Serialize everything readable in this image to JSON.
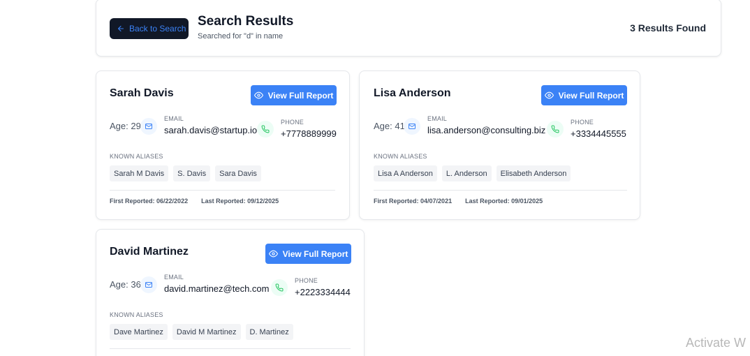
{
  "header": {
    "back_label": "Back to Search",
    "title": "Search Results",
    "subtitle": "Searched for \"d\" in name",
    "result_count": "3 Results Found"
  },
  "labels": {
    "email": "EMAIL",
    "phone": "PHONE",
    "known_aliases": "KNOWN ALIASES",
    "view_report": "View Full Report",
    "first_reported": "First Reported:",
    "last_reported": "Last Reported:"
  },
  "results": [
    {
      "name": "Sarah Davis",
      "age": "Age: 29",
      "email": "sarah.davis@startup.io",
      "phone": "+7778889999",
      "aliases": [
        "Sarah M Davis",
        "S. Davis",
        "Sara Davis"
      ],
      "first_reported": "06/22/2022",
      "last_reported": "09/12/2025"
    },
    {
      "name": "Lisa Anderson",
      "age": "Age: 41",
      "email": "lisa.anderson@consulting.biz",
      "phone": "+3334445555",
      "aliases": [
        "Lisa A Anderson",
        "L. Anderson",
        "Elisabeth Anderson"
      ],
      "first_reported": "04/07/2021",
      "last_reported": "09/01/2025"
    },
    {
      "name": "David Martinez",
      "age": "Age: 36",
      "email": "david.martinez@tech.com",
      "phone": "+2223334444",
      "aliases": [
        "Dave Martinez",
        "David M Martinez",
        "D. Martinez"
      ]
    }
  ],
  "watermark": "Activate W",
  "colors": {
    "accent": "#3b82f6",
    "back_button_bg": "#111827",
    "mail_icon": "#3b82f6",
    "phone_icon": "#22c55e"
  }
}
